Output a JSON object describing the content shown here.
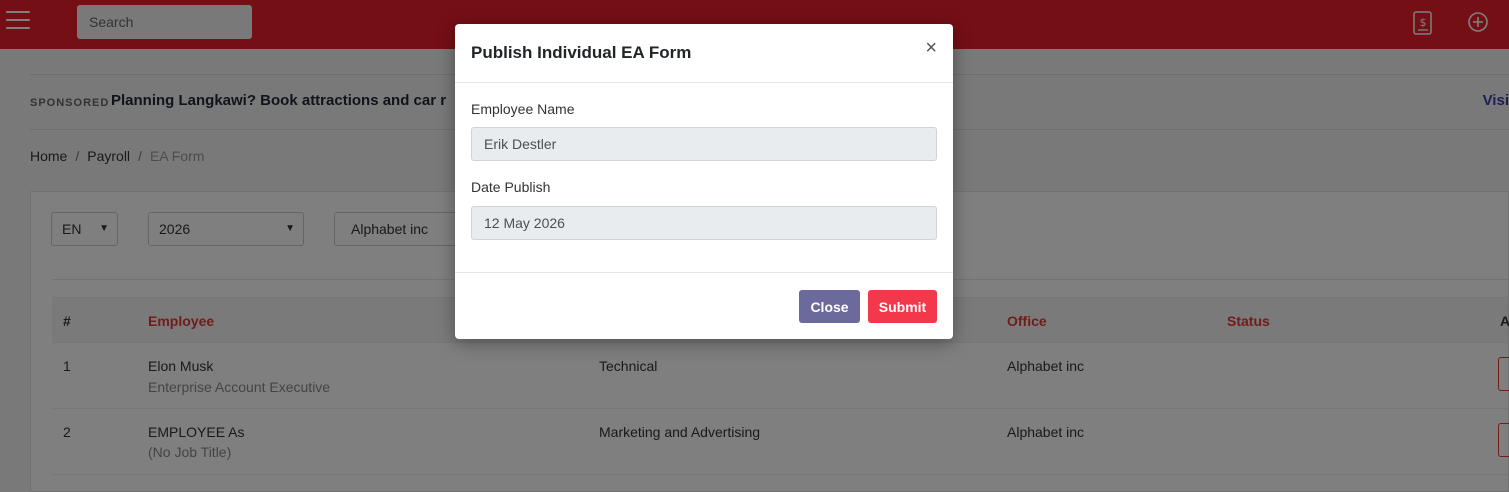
{
  "topbar": {
    "search_placeholder": "Search",
    "icons": [
      "menu-icon",
      "payroll-document-icon",
      "add-circle-icon"
    ],
    "color": "#e91e2a"
  },
  "sponsored": {
    "tag": "SPONSORED",
    "text": "Planning Langkawi? Book attractions and car r",
    "link": "Visi"
  },
  "breadcrumb": {
    "home": "Home",
    "payroll": "Payroll",
    "current": "EA Form"
  },
  "filters": {
    "language": "EN",
    "year": "2026",
    "company": "Alphabet inc"
  },
  "table": {
    "headers": {
      "num": "#",
      "employee": "Employee",
      "office": "Office",
      "status": "Status",
      "action": "A"
    },
    "rows": [
      {
        "num": "1",
        "name": "Elon Musk",
        "title": "Enterprise Account Executive",
        "department": "Technical",
        "office": "Alphabet inc"
      },
      {
        "num": "2",
        "name": "EMPLOYEE As",
        "title": "(No Job Title)",
        "department": "Marketing and Advertising",
        "office": "Alphabet inc"
      }
    ]
  },
  "modal": {
    "title": "Publish Individual EA Form",
    "close_symbol": "×",
    "employee_label": "Employee Name",
    "employee_value": "Erik Destler",
    "date_label": "Date Publish",
    "date_value": "12 May 2026",
    "close_button": "Close",
    "submit_button": "Submit"
  }
}
